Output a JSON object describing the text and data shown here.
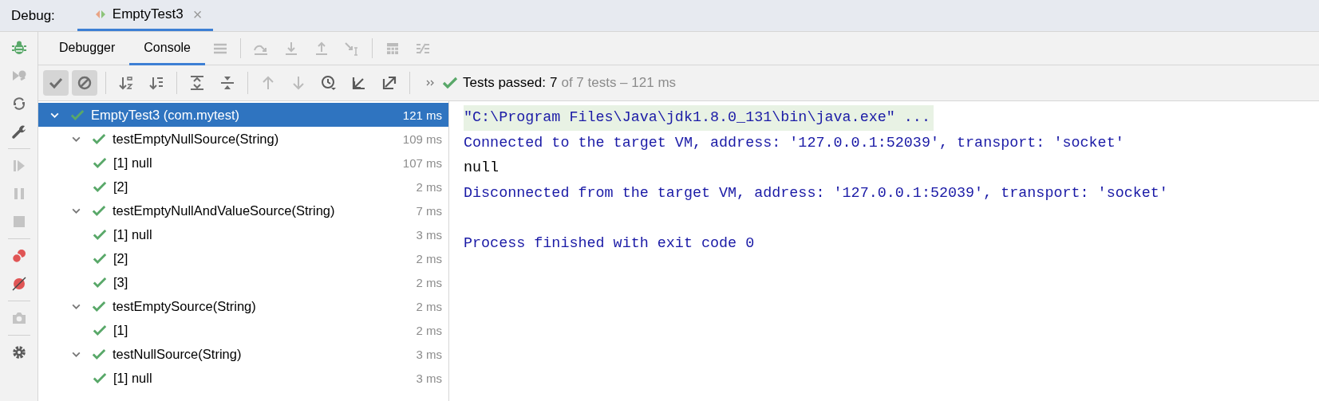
{
  "debug_bar": {
    "label": "Debug:",
    "tab": {
      "title": "EmptyTest3",
      "selected": true,
      "close": "×"
    }
  },
  "tabs": [
    {
      "label": "Debugger",
      "selected": false
    },
    {
      "label": "Console",
      "selected": true
    }
  ],
  "filters": [
    {
      "kind": "passed",
      "on": true
    },
    {
      "kind": "ignored",
      "on": true
    }
  ],
  "status": {
    "label": "Tests passed:",
    "passed": "7",
    "detail": "of 7 tests – 121 ms"
  },
  "tree": [
    {
      "name": "EmptyTest3 (com.mytest)",
      "time": "121 ms",
      "passed": true,
      "selected": true,
      "expanded": true,
      "children": [
        {
          "name": "testEmptyNullSource(String)",
          "time": "109 ms",
          "passed": true,
          "selected": false,
          "expanded": true,
          "children": [
            {
              "name": "[1] null",
              "time": "107 ms",
              "passed": true,
              "selected": false
            },
            {
              "name": "[2]",
              "time": "2 ms",
              "passed": true,
              "selected": false
            }
          ]
        },
        {
          "name": "testEmptyNullAndValueSource(String)",
          "time": "7 ms",
          "passed": true,
          "selected": false,
          "expanded": true,
          "children": [
            {
              "name": "[1] null",
              "time": "3 ms",
              "passed": true,
              "selected": false
            },
            {
              "name": "[2]",
              "time": "2 ms",
              "passed": true,
              "selected": false
            },
            {
              "name": "[3]",
              "time": "2 ms",
              "passed": true,
              "selected": false
            }
          ]
        },
        {
          "name": "testEmptySource(String)",
          "time": "2 ms",
          "passed": true,
          "selected": false,
          "expanded": true,
          "children": [
            {
              "name": "[1]",
              "time": "2 ms",
              "passed": true,
              "selected": false
            }
          ]
        },
        {
          "name": "testNullSource(String)",
          "time": "3 ms",
          "passed": true,
          "selected": false,
          "expanded": true,
          "children": [
            {
              "name": "[1] null",
              "time": "3 ms",
              "passed": true,
              "selected": false
            }
          ]
        }
      ]
    }
  ],
  "console": [
    {
      "kind": "command",
      "text": "\"C:\\Program Files\\Java\\jdk1.8.0_131\\bin\\java.exe\" ..."
    },
    {
      "kind": "info",
      "text": "Connected to the target VM, address: '127.0.0.1:52039', transport: 'socket'"
    },
    {
      "kind": "output",
      "text": "null"
    },
    {
      "kind": "info",
      "text": "Disconnected from the target VM, address: '127.0.0.1:52039', transport: 'socket'"
    },
    {
      "kind": "blank"
    },
    {
      "kind": "info",
      "text": "Process finished with exit code 0"
    }
  ]
}
